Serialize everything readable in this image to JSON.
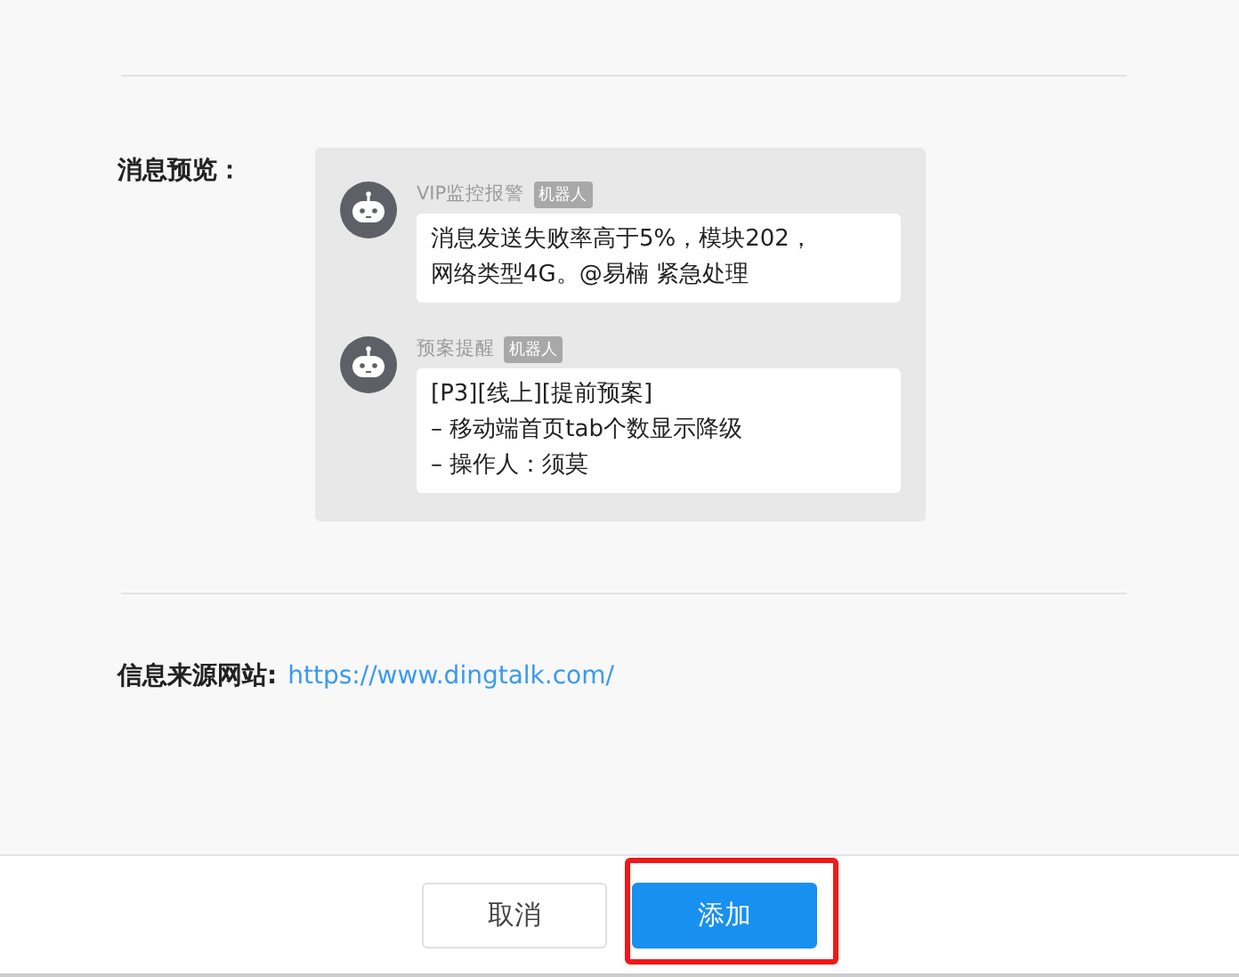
{
  "preview": {
    "label": "消息预览：",
    "messages": [
      {
        "sender": "VIP监控报警",
        "tag": "机器人",
        "lines": [
          "消息发送失败率高于5%，模块202，",
          "网络类型4G。@易楠 紧急处理"
        ]
      },
      {
        "sender": "预案提醒",
        "tag": "机器人",
        "lines": [
          "[P3][线上][提前预案]",
          "– 移动端首页tab个数显示降级",
          "– 操作人：须莫"
        ]
      }
    ]
  },
  "source": {
    "label": "信息来源网站:",
    "link": "https://www.dingtalk.com/"
  },
  "footer": {
    "buttons": [
      {
        "label": "取消",
        "kind": "default",
        "highlighted": false
      },
      {
        "label": "添加",
        "kind": "primary",
        "highlighted": true
      }
    ]
  }
}
